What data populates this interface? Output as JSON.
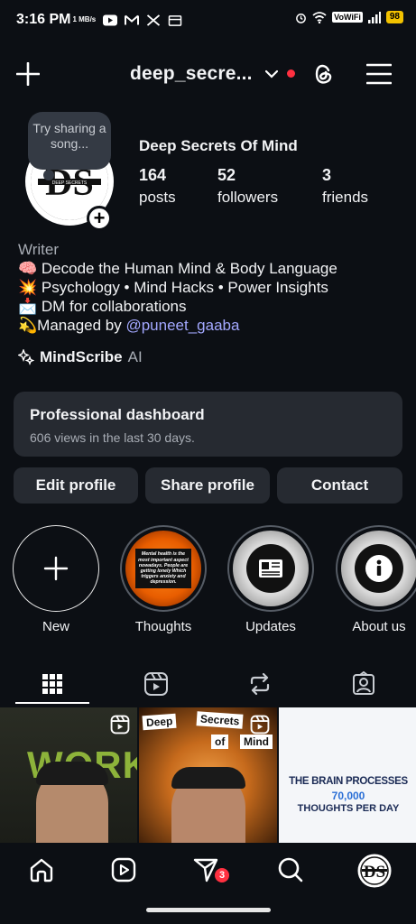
{
  "status_bar": {
    "time": "3:16 PM",
    "speed": "1 MB/s",
    "vowifi": "VoWiFi",
    "battery": "98"
  },
  "header": {
    "username": "deep_secre...",
    "icons": [
      "plus-icon",
      "chevron-down-icon",
      "threads-icon",
      "menu-icon"
    ]
  },
  "profile": {
    "note": "Try sharing a song...",
    "avatar_text": "DS",
    "avatar_caption": "DEEP SECRETS",
    "display_name": "Deep Secrets Of Mind",
    "stats": [
      {
        "value": "164",
        "label": "posts"
      },
      {
        "value": "52",
        "label": "followers"
      },
      {
        "value": "3",
        "label": "friends"
      }
    ]
  },
  "bio": {
    "category": "Writer",
    "lines": [
      "🧠 Decode the Human Mind & Body Language",
      "💥 Psychology • Mind Hacks • Power Insights",
      "📩 DM for collaborations"
    ],
    "managed_prefix": "💫Managed by ",
    "mention": "@puneet_gaaba",
    "ai_name": "MindScribe",
    "ai_suffix": "AI"
  },
  "dashboard": {
    "title": "Professional dashboard",
    "subtitle": "606 views in the last 30 days."
  },
  "actions": {
    "edit": "Edit profile",
    "share": "Share profile",
    "contact": "Contact"
  },
  "highlights": [
    {
      "label": "New"
    },
    {
      "label": "Thoughts",
      "text": "Mental health is the most important aspect nowadays. People are getting lonely Which triggers anxiety and depression."
    },
    {
      "label": "Updates"
    },
    {
      "label": "About us"
    }
  ],
  "tabs": [
    "grid-icon",
    "reels-icon",
    "reposts-icon",
    "tagged-icon"
  ],
  "posts": [
    {
      "text": "WORK"
    },
    {
      "text1": "Deep",
      "text2": "Secrets",
      "text3": "of",
      "text4": "Mind"
    },
    {
      "line1": "THE BRAIN PROCESSES",
      "line2": "70,000",
      "line3": "THOUGHTS PER DAY"
    }
  ],
  "bottom_nav": {
    "badge": "3",
    "avatar_text": "DS"
  },
  "colors": {
    "background": "#0c0f14",
    "card": "#262a31",
    "mention": "#a3a8ff",
    "badge": "#ff3040"
  }
}
